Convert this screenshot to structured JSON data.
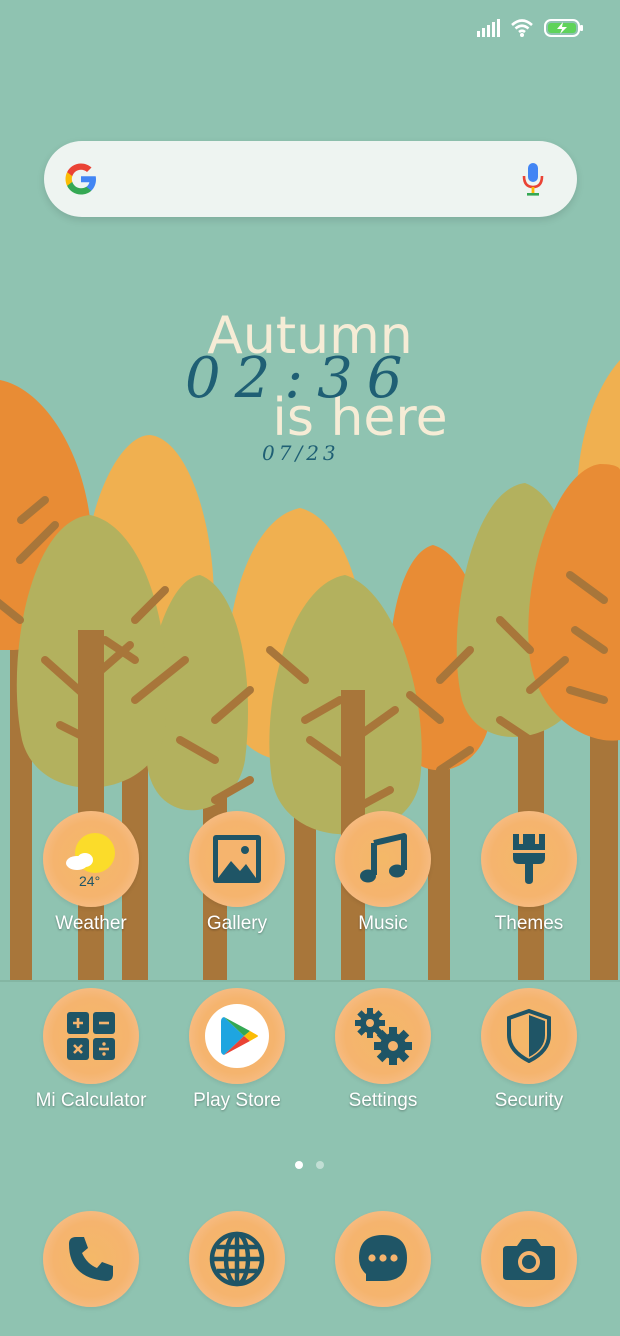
{
  "widget": {
    "line1": "Autumn",
    "time": "02:36",
    "line2": "is here",
    "date": "07/23"
  },
  "apps_row1": [
    {
      "label": "Weather",
      "icon": "weather-sun-cloud-icon",
      "badge": "24°"
    },
    {
      "label": "Gallery",
      "icon": "gallery-image-icon"
    },
    {
      "label": "Music",
      "icon": "music-note-icon"
    },
    {
      "label": "Themes",
      "icon": "paintbrush-icon"
    }
  ],
  "apps_row2": [
    {
      "label": "Mi Calculator",
      "icon": "calculator-icon"
    },
    {
      "label": "Play Store",
      "icon": "play-store-icon"
    },
    {
      "label": "Settings",
      "icon": "gears-icon"
    },
    {
      "label": "Security",
      "icon": "shield-icon"
    }
  ],
  "dock": [
    {
      "icon": "phone-icon"
    },
    {
      "icon": "globe-icon"
    },
    {
      "icon": "message-icon"
    },
    {
      "icon": "camera-icon"
    }
  ],
  "colors": {
    "background": "#8fc3b1",
    "icon_glyph": "#1f5566",
    "bubble": "#f5b46e",
    "battery": "#5fd35a"
  },
  "page_indicator": {
    "current": 1,
    "total": 2
  }
}
